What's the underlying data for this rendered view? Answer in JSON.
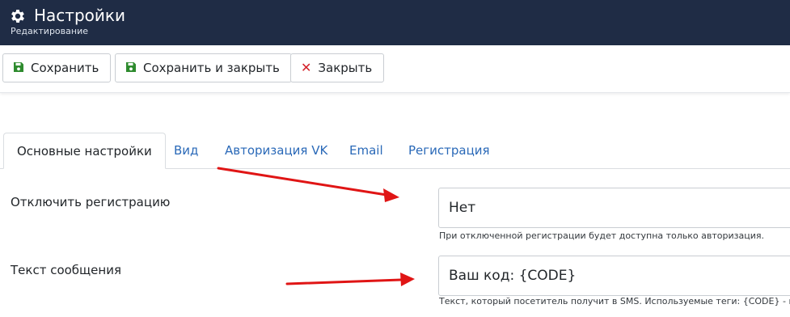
{
  "header": {
    "title": "Настройки",
    "subtitle": "Редактирование",
    "icon": "gear-icon",
    "background": "#1f2c45"
  },
  "toolbar": {
    "save_label": "Сохранить",
    "save_close_label": "Сохранить и закрыть",
    "close_label": "Закрыть",
    "save_icon": "floppy-disk-icon",
    "close_icon": "close-icon",
    "save_icon_color": "#2e8b2e",
    "close_icon_color": "#d4222a"
  },
  "tabs": [
    {
      "label": "Основные настройки",
      "active": true
    },
    {
      "label": "Вид",
      "active": false
    },
    {
      "label": "Авторизация VK",
      "active": false
    },
    {
      "label": "Email",
      "active": false
    },
    {
      "label": "Регистрация",
      "active": false
    }
  ],
  "form": {
    "disable_registration": {
      "label": "Отключить регистрацию",
      "value": "Нет",
      "hint": "При отключенной регистрации будет доступна только авторизация."
    },
    "message_text": {
      "label": "Текст сообщения",
      "value": "Ваш код: {CODE}",
      "hint": "Текст, который посетитель получит в SMS. Используемые теги: {CODE} - код"
    }
  },
  "annotations": {
    "arrow_color": "#e01515"
  }
}
